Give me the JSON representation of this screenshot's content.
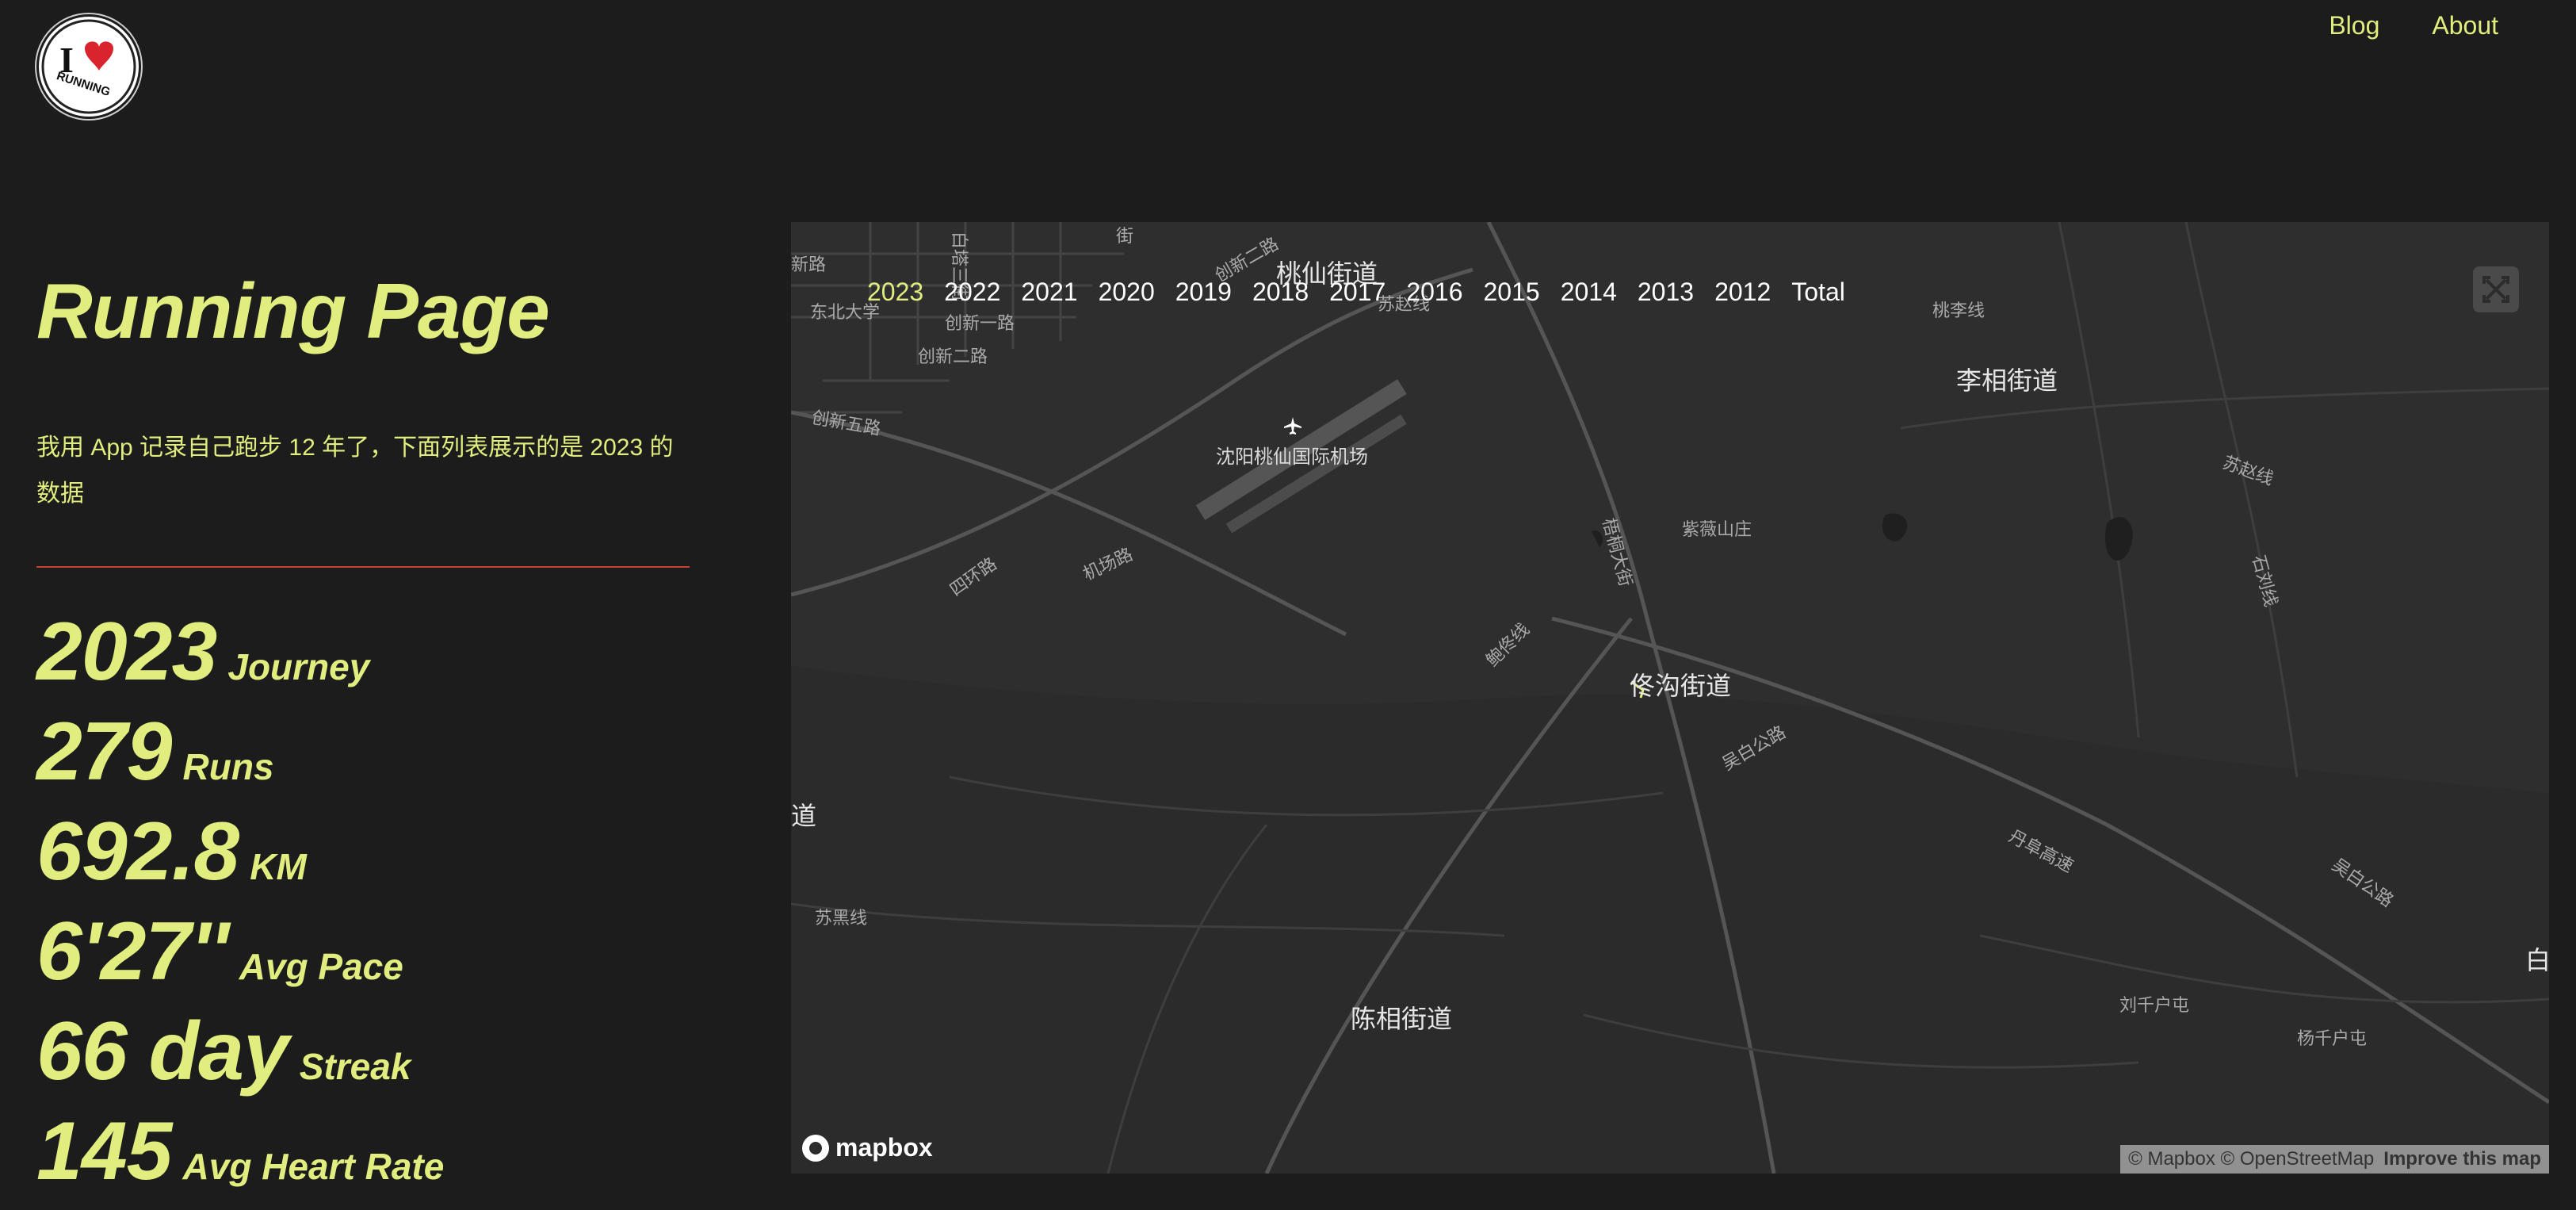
{
  "header": {
    "logo_text_top": "I",
    "logo_text_bottom": "RUNNING",
    "nav": [
      "Blog",
      "About"
    ]
  },
  "page": {
    "title": "Running Page",
    "intro": "我用 App 记录自己跑步 12 年了，下面列表展示的是 2023 的数据"
  },
  "stats": [
    {
      "value": "2023",
      "label": "Journey"
    },
    {
      "value": "279",
      "label": "Runs"
    },
    {
      "value": "692.8",
      "label": "KM"
    },
    {
      "value": "6'27''",
      "label": "Avg Pace"
    },
    {
      "value": "66 day",
      "label": "Streak"
    },
    {
      "value": "145",
      "label": "Avg Heart Rate"
    }
  ],
  "map": {
    "years": [
      "2023",
      "2022",
      "2021",
      "2020",
      "2019",
      "2018",
      "2017",
      "2016",
      "2015",
      "2014",
      "2013",
      "2012",
      "Total"
    ],
    "active_year": "2023",
    "labels": {
      "taoxian": "桃仙街道",
      "lixiang": "李相街道",
      "airport": "沈阳桃仙国际机场",
      "zhuwei": "紫薇山庄",
      "donggou": "佟沟街道",
      "chenxiang": "陈相街道",
      "liuqianhu": "刘千户屯",
      "yangqianhu": "杨千户屯",
      "dongbei_daxue": "东北大学",
      "chuangxin1": "创新一路",
      "chuangxin2": "创新二路",
      "chuangxin5": "创新五路",
      "chuangxin2b": "创新二路",
      "sihuan": "四环路",
      "jichang": "机场路",
      "baotong": "鲍佟线",
      "wutong": "梧桐大街",
      "wubai": "吴白公路",
      "danfu": "丹阜高速",
      "wubai2": "吴白公路",
      "suhei": "苏黑线",
      "suzhao": "苏赵线",
      "shiliu": "石刘线",
      "taoli": "桃李线",
      "baita": "白塔三街",
      "suzhao2": "苏赵线",
      "lu_left": "新路",
      "dao_left": "道",
      "bai_right": "白",
      "jie_top": "街"
    },
    "logo": "mapbox",
    "attribution": "© Mapbox © OpenStreetMap",
    "improve": "Improve this map"
  },
  "colors": {
    "background": "#1c1c1c",
    "accent": "#e1ed7e",
    "divider": "#c5432f",
    "map_bg": "#2c2c2c"
  }
}
